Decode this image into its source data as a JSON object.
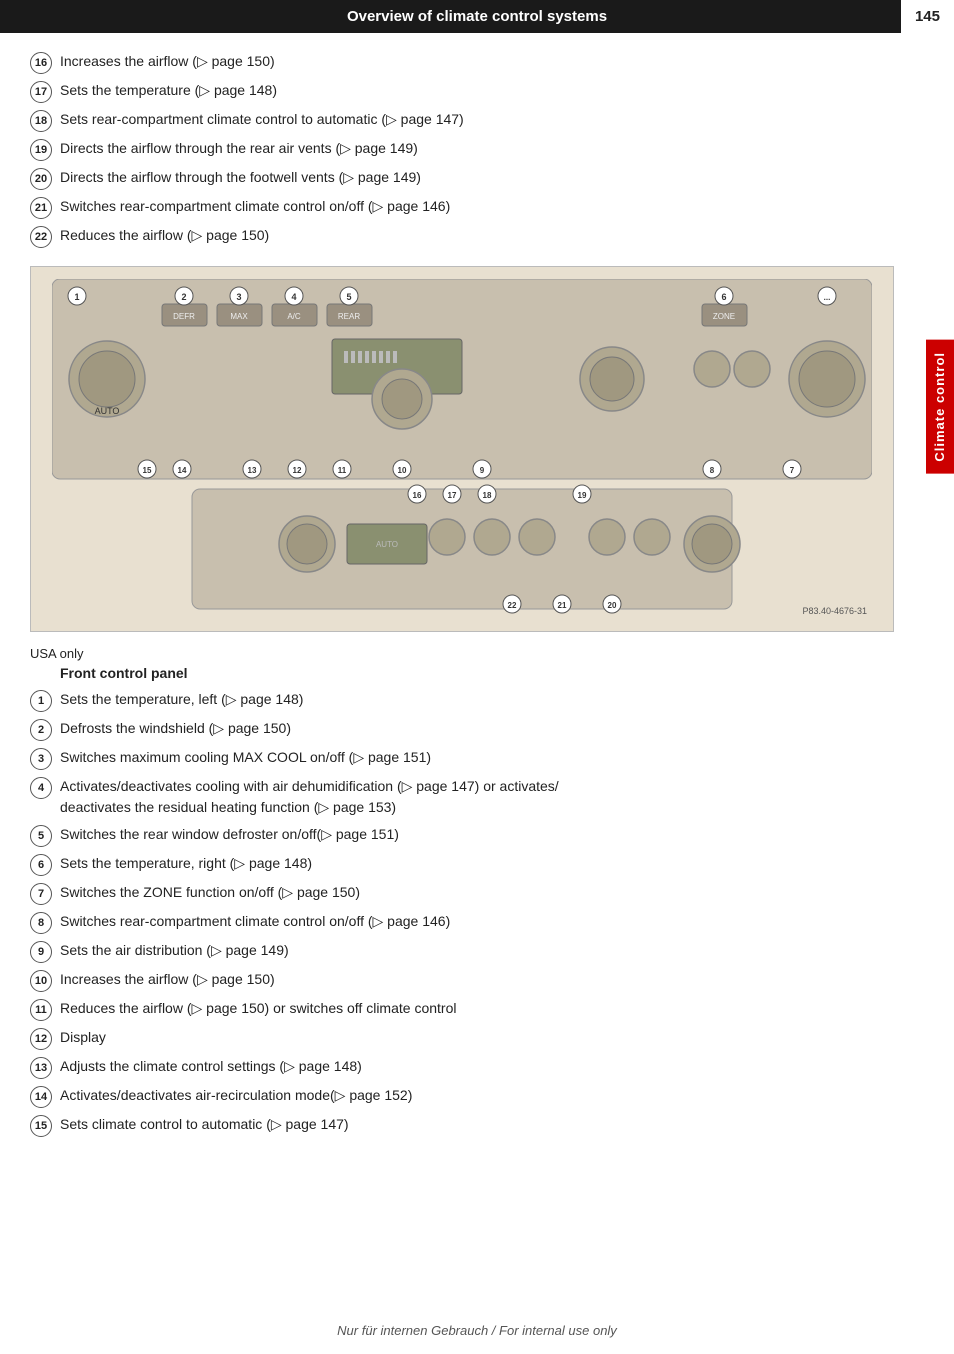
{
  "header": {
    "title": "Overview of climate control systems",
    "page_number": "145"
  },
  "side_tab": {
    "label": "Climate control"
  },
  "rear_list": [
    {
      "num": "16",
      "text": "Increases the airflow (▷ page 150)"
    },
    {
      "num": "17",
      "text": "Sets the temperature (▷ page 148)"
    },
    {
      "num": "18",
      "text": "Sets rear-compartment climate control to automatic (▷ page 147)"
    },
    {
      "num": "19",
      "text": "Directs the airflow through the rear air vents (▷ page 149)"
    },
    {
      "num": "20",
      "text": "Directs the airflow through the footwell vents (▷ page 149)"
    },
    {
      "num": "21",
      "text": "Switches rear-compartment climate control on/off (▷ page 146)"
    },
    {
      "num": "22",
      "text": "Reduces the airflow (▷ page 150)"
    }
  ],
  "diagram_ref": "P83.40-4676-31",
  "usa_only": "USA only",
  "front_panel_title": "Front control panel",
  "front_list": [
    {
      "num": "1",
      "text": "Sets the temperature, left (▷ page 148)"
    },
    {
      "num": "2",
      "text": "Defrosts the windshield (▷ page 150)"
    },
    {
      "num": "3",
      "text": "Switches maximum cooling MAX COOL on/off (▷ page 151)"
    },
    {
      "num": "4",
      "text": "Activates/deactivates cooling with air dehumidification (▷ page 147) or activates/\ndeactivates the residual heating function (▷ page 153)"
    },
    {
      "num": "5",
      "text": "Switches the rear window defroster on/off(▷ page 151)"
    },
    {
      "num": "6",
      "text": "Sets the temperature, right (▷ page 148)"
    },
    {
      "num": "7",
      "text": "Switches the ZONE function on/off (▷ page 150)"
    },
    {
      "num": "8",
      "text": "Switches rear-compartment climate control on/off (▷ page 146)"
    },
    {
      "num": "9",
      "text": "Sets the air distribution (▷ page 149)"
    },
    {
      "num": "10",
      "text": "Increases the airflow (▷ page 150)"
    },
    {
      "num": "11",
      "text": "Reduces the airflow (▷ page 150) or switches off climate control"
    },
    {
      "num": "12",
      "text": "Display"
    },
    {
      "num": "13",
      "text": "Adjusts the climate control settings (▷ page 148)"
    },
    {
      "num": "14",
      "text": "Activates/deactivates air-recirculation mode(▷ page 152)"
    },
    {
      "num": "15",
      "text": "Sets climate control to automatic (▷ page 147)"
    }
  ],
  "footer_text": "Nur für internen Gebrauch / For internal use only"
}
